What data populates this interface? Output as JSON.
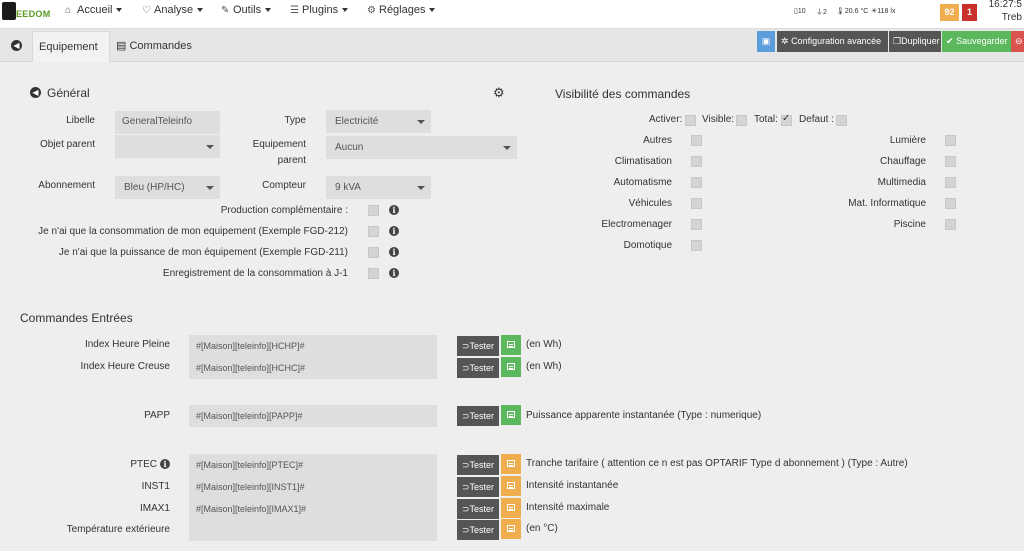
{
  "navbar": {
    "logo_text": "EEDOM",
    "menu": [
      {
        "label": "Accueil",
        "icon": "home-icon"
      },
      {
        "label": "Analyse",
        "icon": "stethoscope-icon"
      },
      {
        "label": "Outils",
        "icon": "wrench-icon"
      },
      {
        "label": "Plugins",
        "icon": "tasks-icon"
      },
      {
        "label": "Réglages",
        "icon": "gear-icon"
      }
    ],
    "status": {
      "doors": "10",
      "plugs": "2",
      "temperature": "20.6 °C",
      "light": "118 lx"
    },
    "badge_orange": "92",
    "badge_red": "1",
    "clock_time": "16:27:5",
    "clock_place": "Treb"
  },
  "tabbar": {
    "tab_equipment": "Equipement",
    "tab_commands": "Commandes",
    "btn_advanced": "Configuration avancée",
    "btn_duplicate": "Dupliquer",
    "btn_save": "Sauvegarder"
  },
  "general": {
    "title": "Général",
    "libelle_label": "Libelle",
    "libelle_value": "GeneralTeleinfo",
    "type_label": "Type",
    "type_value": "Electricité",
    "objet_parent_label": "Objet parent",
    "objet_parent_value": "",
    "equipement_parent_label_1": "Equipement",
    "equipement_parent_label_2": "parent",
    "equipement_parent_value": "Aucun",
    "abonnement_label": "Abonnement",
    "abonnement_value": "Bleu (HP/HC)",
    "compteur_label": "Compteur",
    "compteur_value": "9 kVA",
    "production_label": "Production complémentaire :",
    "conso_fgd212_label": "Je n'ai que la consommation de mon equipement (Exemple FGD-212)",
    "puissance_fgd211_label": "Je n'ai que la puissance de mon équipement (Exemple FGD-211)",
    "enregistrement_label": "Enregistrement de la consommation à J-1"
  },
  "visibility": {
    "title": "Visibilité des commandes",
    "activer_label": "Activer:",
    "visible_label": "Visible:",
    "total_label": "Total:",
    "defaut_label": "Defaut :",
    "left_items": [
      "Autres",
      "Climatisation",
      "Automatisme",
      "Véhicules",
      "Electromenager",
      "Domotique"
    ],
    "right_items": [
      "Lumière",
      "Chauffage",
      "Multimedia",
      "Mat. Informatique",
      "Piscine"
    ]
  },
  "commands": {
    "title": "Commandes Entrées",
    "tester_label": "Tester",
    "rows": [
      {
        "label": "Index Heure Pleine",
        "value": "#[Maison][teleinfo][HCHP]#",
        "unit": "(en Wh)",
        "color": "#5cb85c"
      },
      {
        "label": "Index Heure Creuse",
        "value": "#[Maison][teleinfo][HCHC]#",
        "unit": "(en Wh)",
        "color": "#5cb85c"
      },
      {
        "label": "PAPP",
        "value": "#[Maison][teleinfo][PAPP]#",
        "unit": "Puissance apparente instantanée (Type : numerique)",
        "color": "#5cb85c"
      },
      {
        "label": "PTEC",
        "value": "#[Maison][teleinfo][PTEC]#",
        "unit": "Tranche tarifaire ( attention ce n est pas OPTARIF Type d abonnement ) (Type : Autre)",
        "color": "#f0ad4e"
      },
      {
        "label": "INST1",
        "value": "#[Maison][teleinfo][INST1]#",
        "unit": "Intensité instantanée",
        "color": "#f0ad4e"
      },
      {
        "label": "IMAX1",
        "value": "#[Maison][teleinfo][IMAX1]#",
        "unit": "Intensité maximale",
        "color": "#f0ad4e"
      },
      {
        "label": "Température extérieure",
        "value": "",
        "unit": "(en °C)",
        "color": "#f0ad4e"
      }
    ]
  },
  "colors": {
    "blue_btn": "#5c9ddb",
    "dark_btn": "#555555",
    "green_btn": "#5cb85c",
    "red_btn": "#d9534f",
    "orange_badge": "#f0ad4e",
    "red_badge": "#c9302c"
  }
}
